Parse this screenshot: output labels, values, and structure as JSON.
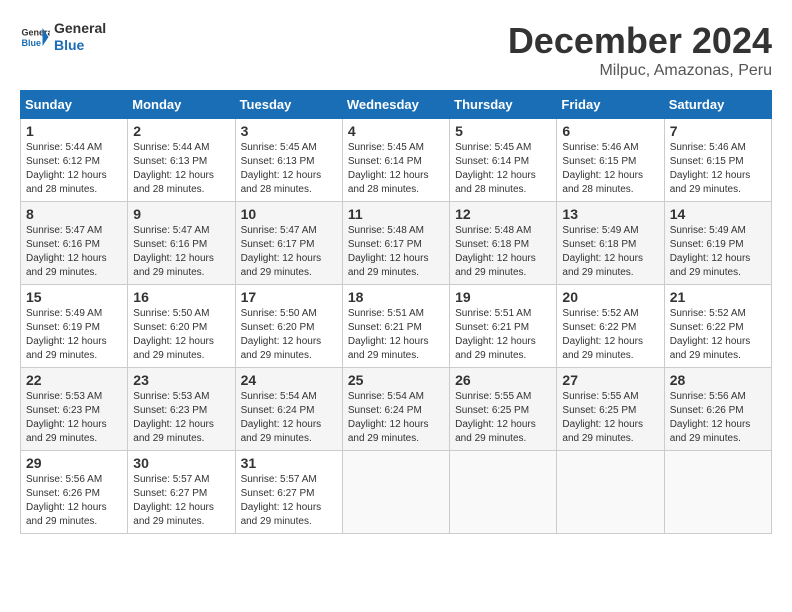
{
  "header": {
    "logo_line1": "General",
    "logo_line2": "Blue",
    "month": "December 2024",
    "location": "Milpuc, Amazonas, Peru"
  },
  "weekdays": [
    "Sunday",
    "Monday",
    "Tuesday",
    "Wednesday",
    "Thursday",
    "Friday",
    "Saturday"
  ],
  "weeks": [
    [
      {
        "day": "1",
        "info": "Sunrise: 5:44 AM\nSunset: 6:12 PM\nDaylight: 12 hours\nand 28 minutes."
      },
      {
        "day": "2",
        "info": "Sunrise: 5:44 AM\nSunset: 6:13 PM\nDaylight: 12 hours\nand 28 minutes."
      },
      {
        "day": "3",
        "info": "Sunrise: 5:45 AM\nSunset: 6:13 PM\nDaylight: 12 hours\nand 28 minutes."
      },
      {
        "day": "4",
        "info": "Sunrise: 5:45 AM\nSunset: 6:14 PM\nDaylight: 12 hours\nand 28 minutes."
      },
      {
        "day": "5",
        "info": "Sunrise: 5:45 AM\nSunset: 6:14 PM\nDaylight: 12 hours\nand 28 minutes."
      },
      {
        "day": "6",
        "info": "Sunrise: 5:46 AM\nSunset: 6:15 PM\nDaylight: 12 hours\nand 28 minutes."
      },
      {
        "day": "7",
        "info": "Sunrise: 5:46 AM\nSunset: 6:15 PM\nDaylight: 12 hours\nand 29 minutes."
      }
    ],
    [
      {
        "day": "8",
        "info": "Sunrise: 5:47 AM\nSunset: 6:16 PM\nDaylight: 12 hours\nand 29 minutes."
      },
      {
        "day": "9",
        "info": "Sunrise: 5:47 AM\nSunset: 6:16 PM\nDaylight: 12 hours\nand 29 minutes."
      },
      {
        "day": "10",
        "info": "Sunrise: 5:47 AM\nSunset: 6:17 PM\nDaylight: 12 hours\nand 29 minutes."
      },
      {
        "day": "11",
        "info": "Sunrise: 5:48 AM\nSunset: 6:17 PM\nDaylight: 12 hours\nand 29 minutes."
      },
      {
        "day": "12",
        "info": "Sunrise: 5:48 AM\nSunset: 6:18 PM\nDaylight: 12 hours\nand 29 minutes."
      },
      {
        "day": "13",
        "info": "Sunrise: 5:49 AM\nSunset: 6:18 PM\nDaylight: 12 hours\nand 29 minutes."
      },
      {
        "day": "14",
        "info": "Sunrise: 5:49 AM\nSunset: 6:19 PM\nDaylight: 12 hours\nand 29 minutes."
      }
    ],
    [
      {
        "day": "15",
        "info": "Sunrise: 5:49 AM\nSunset: 6:19 PM\nDaylight: 12 hours\nand 29 minutes."
      },
      {
        "day": "16",
        "info": "Sunrise: 5:50 AM\nSunset: 6:20 PM\nDaylight: 12 hours\nand 29 minutes."
      },
      {
        "day": "17",
        "info": "Sunrise: 5:50 AM\nSunset: 6:20 PM\nDaylight: 12 hours\nand 29 minutes."
      },
      {
        "day": "18",
        "info": "Sunrise: 5:51 AM\nSunset: 6:21 PM\nDaylight: 12 hours\nand 29 minutes."
      },
      {
        "day": "19",
        "info": "Sunrise: 5:51 AM\nSunset: 6:21 PM\nDaylight: 12 hours\nand 29 minutes."
      },
      {
        "day": "20",
        "info": "Sunrise: 5:52 AM\nSunset: 6:22 PM\nDaylight: 12 hours\nand 29 minutes."
      },
      {
        "day": "21",
        "info": "Sunrise: 5:52 AM\nSunset: 6:22 PM\nDaylight: 12 hours\nand 29 minutes."
      }
    ],
    [
      {
        "day": "22",
        "info": "Sunrise: 5:53 AM\nSunset: 6:23 PM\nDaylight: 12 hours\nand 29 minutes."
      },
      {
        "day": "23",
        "info": "Sunrise: 5:53 AM\nSunset: 6:23 PM\nDaylight: 12 hours\nand 29 minutes."
      },
      {
        "day": "24",
        "info": "Sunrise: 5:54 AM\nSunset: 6:24 PM\nDaylight: 12 hours\nand 29 minutes."
      },
      {
        "day": "25",
        "info": "Sunrise: 5:54 AM\nSunset: 6:24 PM\nDaylight: 12 hours\nand 29 minutes."
      },
      {
        "day": "26",
        "info": "Sunrise: 5:55 AM\nSunset: 6:25 PM\nDaylight: 12 hours\nand 29 minutes."
      },
      {
        "day": "27",
        "info": "Sunrise: 5:55 AM\nSunset: 6:25 PM\nDaylight: 12 hours\nand 29 minutes."
      },
      {
        "day": "28",
        "info": "Sunrise: 5:56 AM\nSunset: 6:26 PM\nDaylight: 12 hours\nand 29 minutes."
      }
    ],
    [
      {
        "day": "29",
        "info": "Sunrise: 5:56 AM\nSunset: 6:26 PM\nDaylight: 12 hours\nand 29 minutes."
      },
      {
        "day": "30",
        "info": "Sunrise: 5:57 AM\nSunset: 6:27 PM\nDaylight: 12 hours\nand 29 minutes."
      },
      {
        "day": "31",
        "info": "Sunrise: 5:57 AM\nSunset: 6:27 PM\nDaylight: 12 hours\nand 29 minutes."
      },
      {
        "day": "",
        "info": ""
      },
      {
        "day": "",
        "info": ""
      },
      {
        "day": "",
        "info": ""
      },
      {
        "day": "",
        "info": ""
      }
    ]
  ]
}
